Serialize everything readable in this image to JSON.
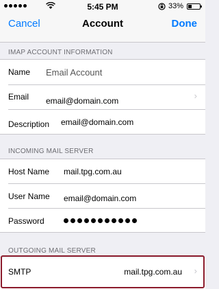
{
  "status_bar": {
    "time": "5:45 PM",
    "battery_pct": "33%",
    "battery_level": 0.33,
    "icons": [
      "signal-dots-icon",
      "wifi-icon",
      "orientation-lock-icon",
      "battery-icon"
    ]
  },
  "nav": {
    "cancel_label": "Cancel",
    "title": "Account",
    "done_label": "Done"
  },
  "imap": {
    "header": "IMAP ACCOUNT INFORMATION",
    "name_label": "Name",
    "name_value": "Email Account",
    "email_label": "Email",
    "email_value": "email@domain.com",
    "description_label": "Description",
    "description_value": "email@domain.com"
  },
  "incoming": {
    "header": "INCOMING MAIL SERVER",
    "host_label": "Host Name",
    "host_value": "mail.tpg.com.au",
    "user_label": "User Name",
    "user_value": "email@domain.com",
    "password_label": "Password",
    "password_mask_count": 11
  },
  "outgoing": {
    "header": "OUTGOING MAIL SERVER",
    "smtp_label": "SMTP",
    "smtp_value": "mail.tpg.com.au"
  },
  "colors": {
    "accent": "#007aff",
    "highlight": "#8b1a2b"
  }
}
